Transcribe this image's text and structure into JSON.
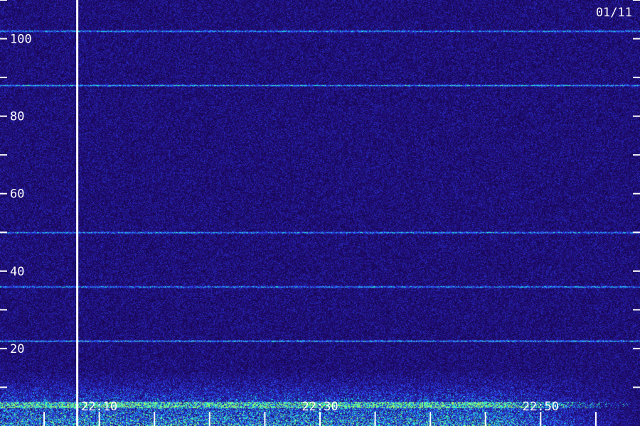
{
  "chart_data": {
    "type": "heatmap",
    "title": "",
    "date_label": "01/11",
    "ylabel": "",
    "xlabel": "",
    "ylim": [
      0,
      110
    ],
    "y_label_ticks": [
      20,
      40,
      60,
      80,
      100
    ],
    "y_minor_ticks": [
      10,
      30,
      50,
      70,
      90,
      110
    ],
    "x_range": [
      "22:01",
      "22:59"
    ],
    "x_label_ticks": [
      "22:10",
      "22:30",
      "22:50"
    ],
    "x_minor_ticks": [
      "22:05",
      "22:15",
      "22:20",
      "22:25",
      "22:35",
      "22:40",
      "22:45",
      "22:55"
    ],
    "marker_time": "22:08",
    "persistent_lines_y": [
      102,
      88,
      50,
      36,
      22
    ],
    "colors": {
      "low": "#1a0850",
      "mid": "#2a3cff",
      "high": "#33ffd0",
      "peak": "#aaff55",
      "axis": "#ffffff"
    }
  }
}
